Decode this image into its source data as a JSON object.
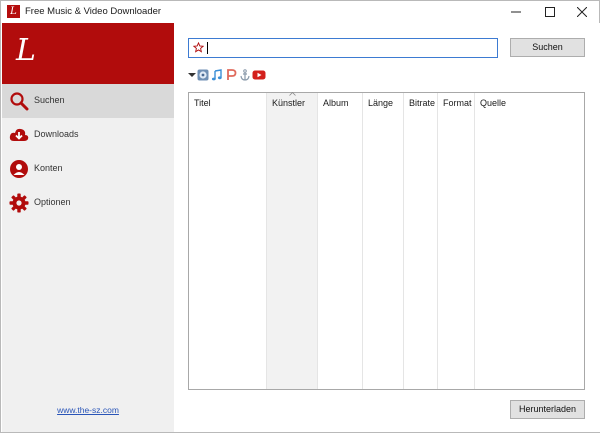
{
  "window": {
    "title": "Free Music & Video Downloader"
  },
  "sidebar": {
    "logo_glyph": "L",
    "items": [
      {
        "label": "Suchen",
        "icon": "search-icon",
        "active": true
      },
      {
        "label": "Downloads",
        "icon": "cloud-download-icon",
        "active": false
      },
      {
        "label": "Konten",
        "icon": "user-icon",
        "active": false
      },
      {
        "label": "Optionen",
        "icon": "gear-icon",
        "active": false
      }
    ],
    "footer_link": "www.the-sz.com"
  },
  "search": {
    "value": "",
    "button_label": "Suchen"
  },
  "sources": [
    {
      "icon": "dropdown-arrow-icon"
    },
    {
      "icon": "globe-music-icon"
    },
    {
      "icon": "music-note-icon"
    },
    {
      "icon": "pandora-icon"
    },
    {
      "icon": "anchor-icon"
    },
    {
      "icon": "youtube-icon"
    }
  ],
  "table": {
    "columns": [
      "Titel",
      "Künstler",
      "Album",
      "Länge",
      "Bitrate",
      "Format",
      "Quelle"
    ],
    "sorted_column": "Künstler",
    "rows": []
  },
  "actions": {
    "download_label": "Herunterladen"
  },
  "colors": {
    "brand": "#b10c0c",
    "accent": "#3d7bd2",
    "link": "#2a55b8"
  }
}
